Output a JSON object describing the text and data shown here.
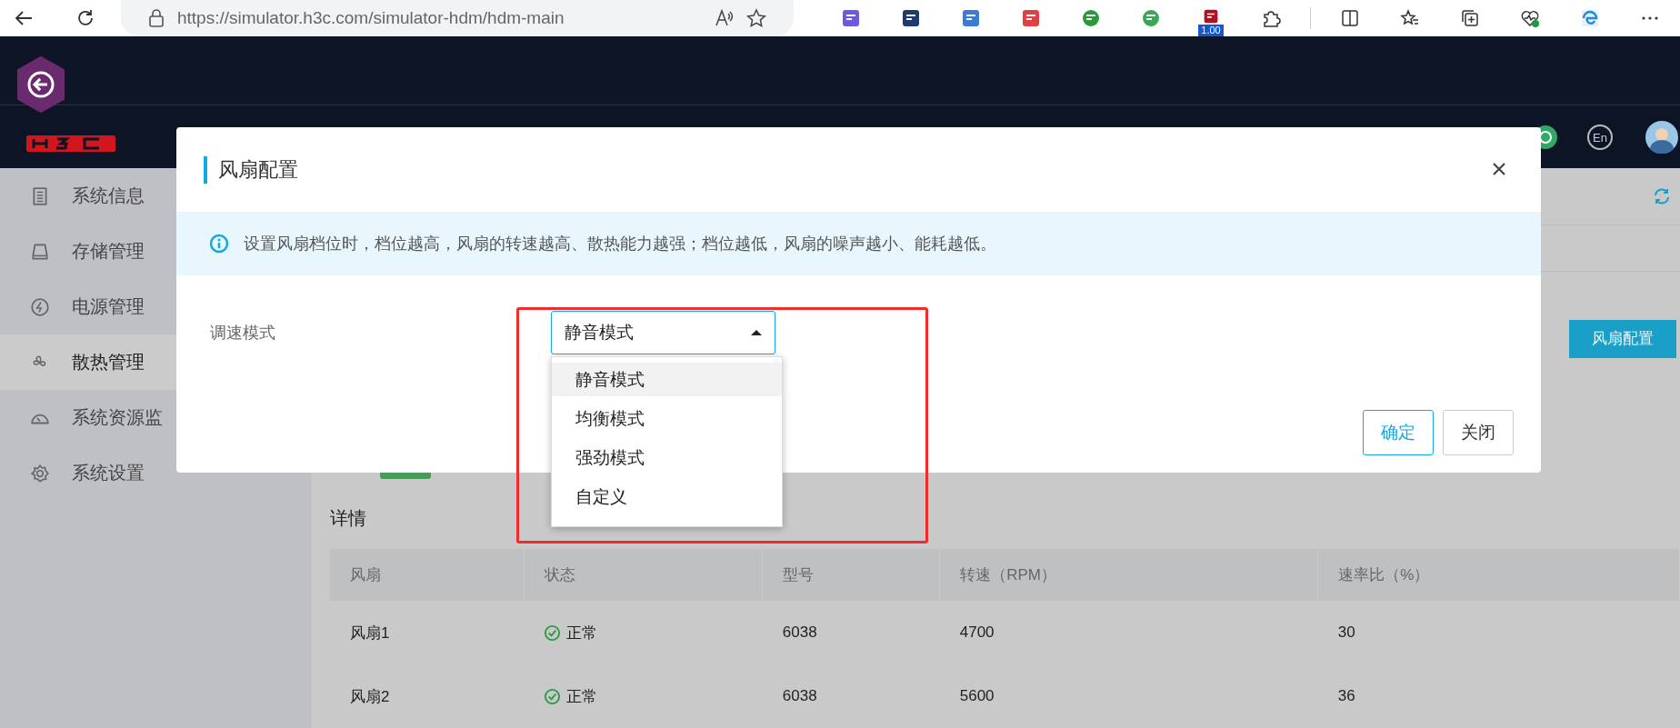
{
  "browser": {
    "url": "https://simulator.h3c.com/simulator-hdm/hdm-main",
    "extension_badge": "1.00"
  },
  "header": {
    "language": "En"
  },
  "sidebar": {
    "items": [
      {
        "label": "系统信息",
        "kind": "list",
        "selected": false
      },
      {
        "label": "存储管理",
        "kind": "disk",
        "selected": false
      },
      {
        "label": "电源管理",
        "kind": "power",
        "selected": false
      },
      {
        "label": "散热管理",
        "kind": "fan",
        "selected": true
      },
      {
        "label": "系统资源监",
        "kind": "gauge",
        "selected": false
      },
      {
        "label": "系统设置",
        "kind": "gear",
        "selected": false
      }
    ]
  },
  "toolbar": {
    "button": "风扇配置"
  },
  "details": {
    "title": "详情",
    "columns": [
      "风扇",
      "状态",
      "型号",
      "转速（RPM）",
      "速率比（%）"
    ],
    "rows": [
      {
        "fan": "风扇1",
        "status": {
          "kind": "ok",
          "label": "正常"
        },
        "model": "6038",
        "speed": "4700",
        "ratio": "30"
      },
      {
        "fan": "风扇2",
        "status": {
          "kind": "ok",
          "label": "正常"
        },
        "model": "6038",
        "speed": "5600",
        "ratio": "36"
      }
    ]
  },
  "dialog": {
    "title": "风扇配置",
    "info": "设置风扇档位时，档位越高，风扇的转速越高、散热能力越强；档位越低，风扇的噪声越小、能耗越低。",
    "field": {
      "label": "调速模式",
      "value": "静音模式",
      "expanded": true
    },
    "options": [
      {
        "label": "静音模式",
        "selected": true
      },
      {
        "label": "均衡模式",
        "selected": false
      },
      {
        "label": "强劲模式",
        "selected": false
      },
      {
        "label": "自定义",
        "selected": false
      }
    ],
    "buttons": [
      {
        "label": "确定",
        "kind": "primary"
      },
      {
        "label": "关闭",
        "kind": "default"
      }
    ]
  }
}
